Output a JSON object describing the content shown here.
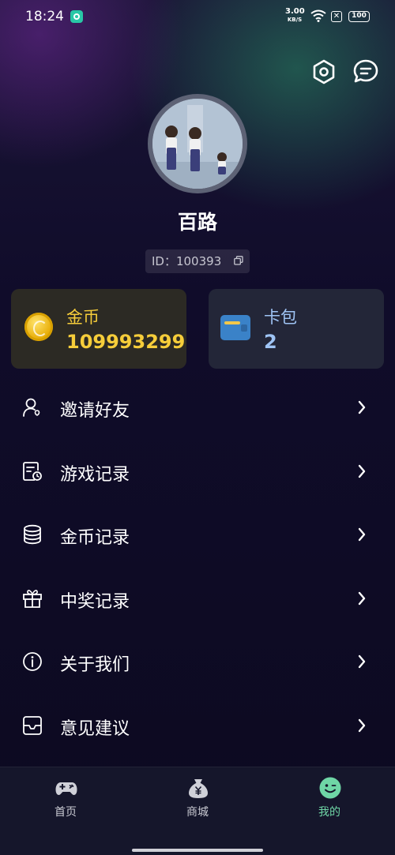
{
  "status_bar": {
    "time": "18:24",
    "speed_value": "3.00",
    "speed_unit": "KB/S",
    "battery": "100",
    "icons": [
      "app-icon",
      "wifi-icon",
      "x-box-icon",
      "battery-icon"
    ]
  },
  "header": {
    "icons": [
      "gear-icon",
      "chat-icon"
    ]
  },
  "profile": {
    "name": "百路",
    "id_text": "ID：100393"
  },
  "cards": {
    "coin": {
      "title": "金币",
      "value": "109993299",
      "color": "#f6cd3a"
    },
    "wallet": {
      "title": "卡包",
      "value": "2",
      "color": "#9fc4f5"
    }
  },
  "menu": {
    "items": [
      {
        "label": "邀请好友",
        "icon": "invite-friend-icon"
      },
      {
        "label": "游戏记录",
        "icon": "game-record-icon"
      },
      {
        "label": "金币记录",
        "icon": "coin-record-icon"
      },
      {
        "label": "中奖记录",
        "icon": "gift-icon"
      },
      {
        "label": "关于我们",
        "icon": "info-icon"
      },
      {
        "label": "意见建议",
        "icon": "feedback-icon"
      }
    ]
  },
  "bottom_nav": {
    "items": [
      {
        "label": "首页",
        "icon": "gamepad-icon",
        "active": false
      },
      {
        "label": "商城",
        "icon": "money-bag-icon",
        "active": false
      },
      {
        "label": "我的",
        "icon": "smiley-icon",
        "active": true
      }
    ],
    "active_color": "#6fd6a6"
  }
}
